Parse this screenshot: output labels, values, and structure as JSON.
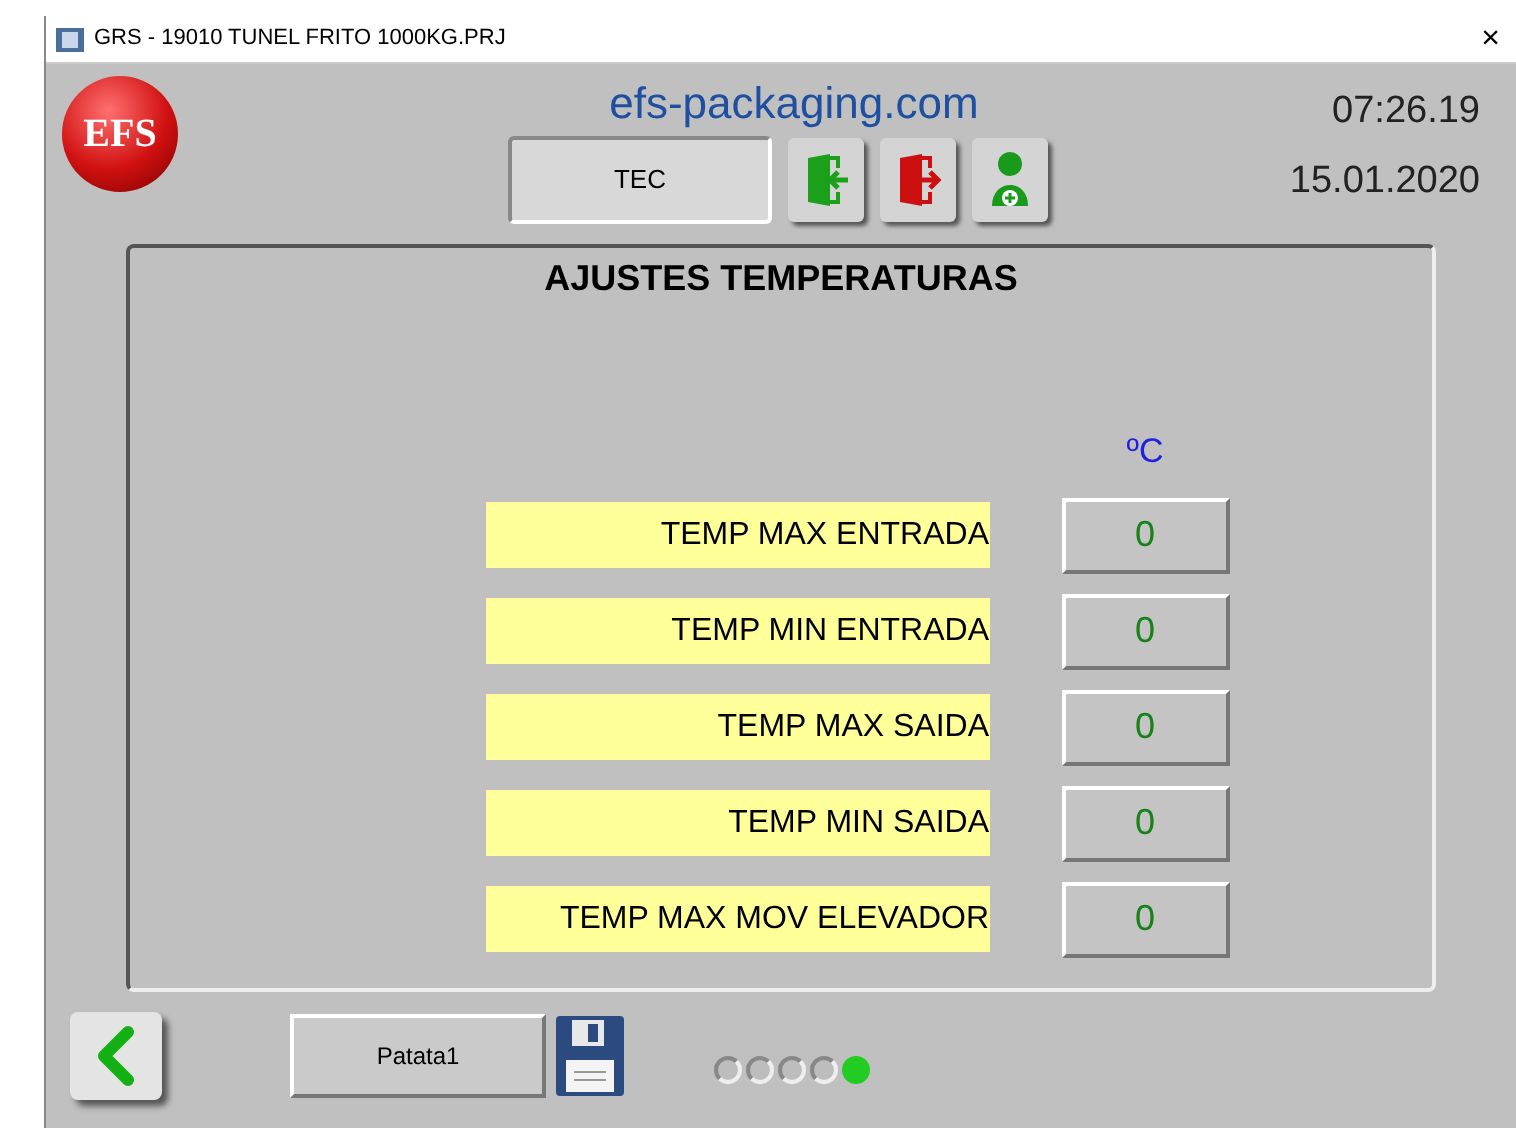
{
  "window": {
    "title": "GRS - 19010 TUNEL FRITO 1000KG.PRJ",
    "close": "×"
  },
  "header": {
    "logo": "EFS",
    "website": "efs-packaging.com",
    "user": "TEC",
    "time": "07:26.19",
    "date": "15.01.2020"
  },
  "panel": {
    "title": "AJUSTES TEMPERATURAS",
    "unit": "ºC",
    "rows": [
      {
        "label": "TEMP MAX ENTRADA",
        "value": "0"
      },
      {
        "label": "TEMP MIN ENTRADA",
        "value": "0"
      },
      {
        "label": "TEMP MAX SAIDA",
        "value": "0"
      },
      {
        "label": "TEMP MIN SAIDA",
        "value": "0"
      },
      {
        "label": "TEMP MAX MOV ELEVADOR",
        "value": "0"
      }
    ]
  },
  "footer": {
    "recipe": "Patata1",
    "pages": [
      {
        "selected": false
      },
      {
        "selected": false
      },
      {
        "selected": false
      },
      {
        "selected": false
      },
      {
        "selected": true
      }
    ]
  }
}
